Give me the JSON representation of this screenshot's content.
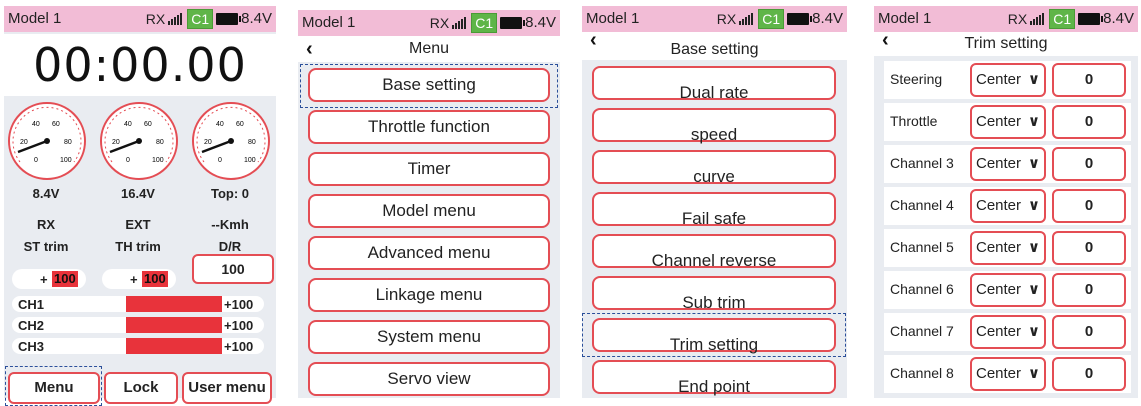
{
  "status": {
    "model": "Model 1",
    "rx": "RX",
    "channel": "C1",
    "voltage": "8.4V"
  },
  "home": {
    "time": "00:00.00",
    "gauges": [
      {
        "ticks": [
          "0",
          "20",
          "40",
          "60",
          "80",
          "100"
        ]
      },
      {
        "ticks": [
          "0",
          "20",
          "40",
          "60",
          "80",
          "100"
        ]
      },
      {
        "ticks": [
          "0",
          "20",
          "40",
          "60",
          "80",
          "100"
        ]
      }
    ],
    "rx_voltage": "8.4V",
    "ext_voltage": "16.4V",
    "top_speed": "Top: 0",
    "rx_label": "RX",
    "ext_label": "EXT",
    "speed_unit": "--Kmh",
    "st_trim_label": "ST trim",
    "th_trim_label": "TH trim",
    "dr_label": "D/R",
    "st_trim_sign": "+",
    "st_trim_value": "100",
    "th_trim_sign": "+",
    "th_trim_value": "100",
    "dr_value": "100",
    "channels": [
      {
        "name": "CH1",
        "value": "+100",
        "fill": 1.0
      },
      {
        "name": "CH2",
        "value": "+100",
        "fill": 1.0
      },
      {
        "name": "CH3",
        "value": "+100",
        "fill": 1.0
      }
    ],
    "buttons": {
      "menu": "Menu",
      "lock": "Lock",
      "user_menu": "User menu"
    }
  },
  "menu": {
    "title": "Menu",
    "items": [
      "Base setting",
      "Throttle function",
      "Timer",
      "Model menu",
      "Advanced menu",
      "Linkage menu",
      "System menu",
      "Servo view"
    ]
  },
  "base_setting": {
    "title": "Base setting",
    "items": [
      "Dual rate",
      "speed",
      "curve",
      "Fail safe",
      "Channel reverse",
      "Sub trim",
      "Trim setting",
      "End point"
    ]
  },
  "trim_setting": {
    "title": "Trim setting",
    "rows": [
      {
        "name": "Steering",
        "mode": "Center",
        "value": "0"
      },
      {
        "name": "Throttle",
        "mode": "Center",
        "value": "0"
      },
      {
        "name": "Channel 3",
        "mode": "Center",
        "value": "0"
      },
      {
        "name": "Channel 4",
        "mode": "Center",
        "value": "0"
      },
      {
        "name": "Channel 5",
        "mode": "Center",
        "value": "0"
      },
      {
        "name": "Channel 6",
        "mode": "Center",
        "value": "0"
      },
      {
        "name": "Channel 7",
        "mode": "Center",
        "value": "0"
      },
      {
        "name": "Channel 8",
        "mode": "Center",
        "value": "0"
      }
    ]
  },
  "colors": {
    "accent": "#e44d54",
    "status_bg": "#f2bcd6",
    "battery_tag": "#5fb548",
    "bar_fill": "#e8333b"
  }
}
